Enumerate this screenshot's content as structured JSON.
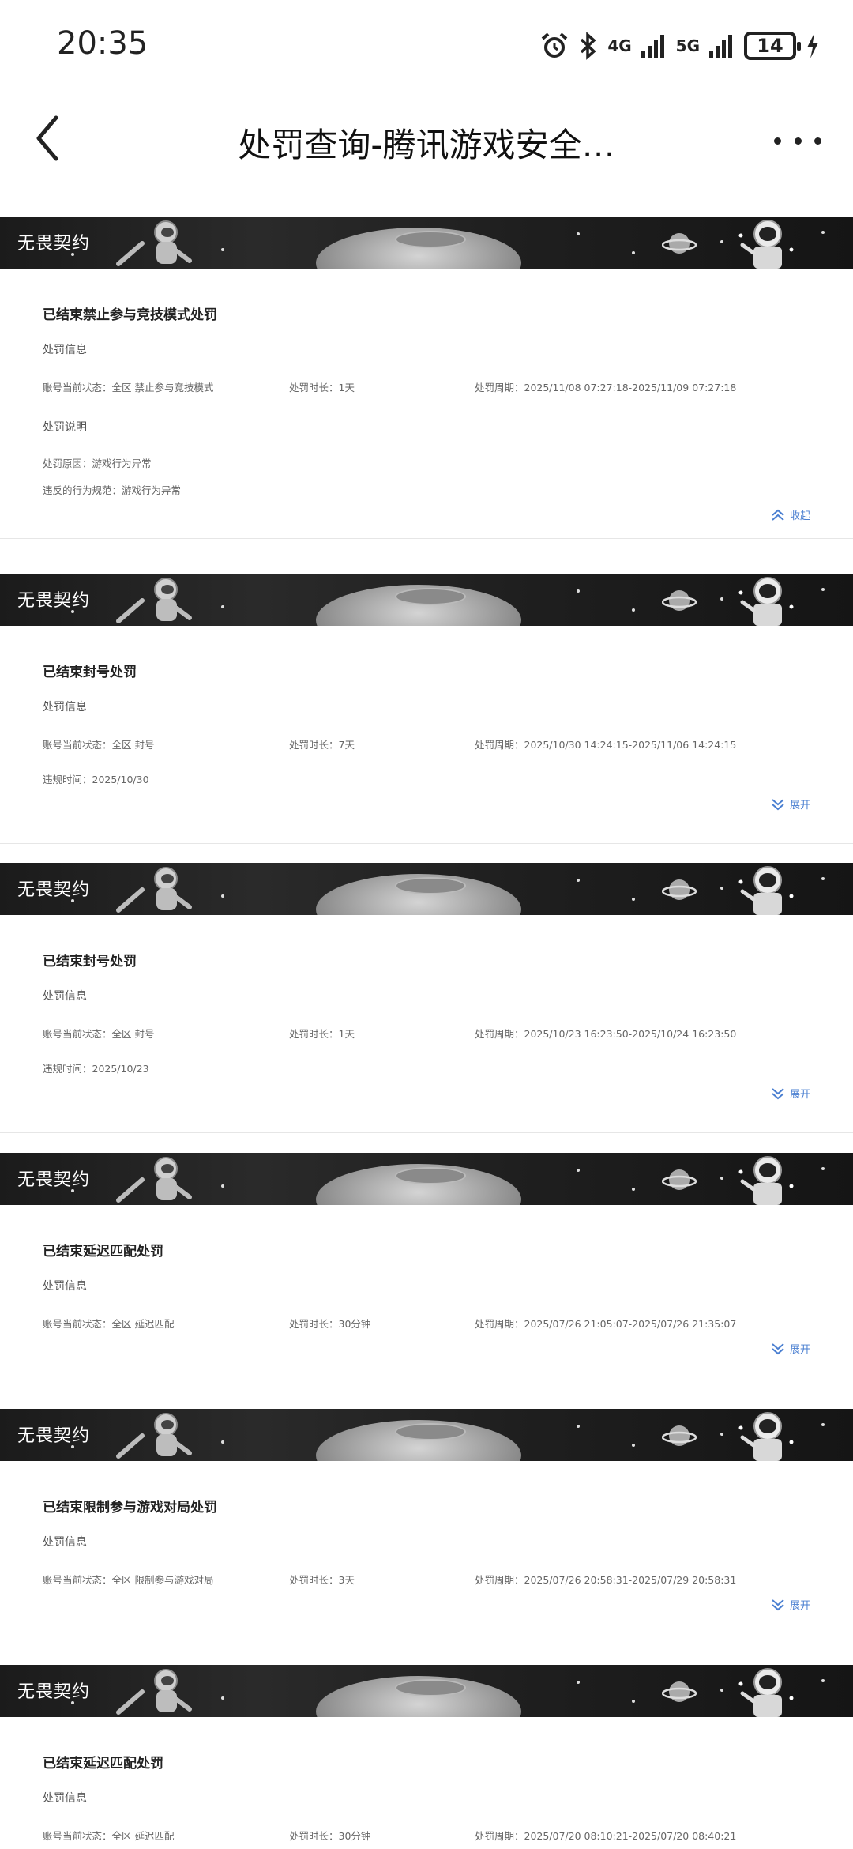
{
  "status_bar": {
    "time": "20:35",
    "net_4g": "4G",
    "net_5g": "5G",
    "battery": "14",
    "icons": [
      "alarm-icon",
      "bluetooth-icon",
      "signal-4g-icon",
      "signal-5g-icon",
      "battery-icon",
      "charging-icon"
    ]
  },
  "nav": {
    "title": "处罚查询-腾讯游戏安全…",
    "back_icon": "back-chevron-icon",
    "more_icon": "more-dots-icon"
  },
  "banner_label": "无畏契约",
  "labels": {
    "info_section": "处罚信息",
    "desc_section": "处罚说明",
    "collapse": "收起",
    "expand": "展开"
  },
  "cards": [
    {
      "title": "已结束禁止参与竞技模式处罚",
      "status": "账号当前状态：全区 禁止参与竞技模式",
      "duration": "处罚时长：1天",
      "period": "处罚周期：2025/11/08 07:27:18-2025/11/09 07:27:18",
      "reason": "处罚原因：游戏行为异常",
      "rule": "违反的行为规范：游戏行为异常",
      "expanded": true
    },
    {
      "title": "已结束封号处罚",
      "status": "账号当前状态：全区 封号",
      "duration": "处罚时长：7天",
      "period": "处罚周期：2025/10/30 14:24:15-2025/11/06 14:24:15",
      "violation_time": "违规时间：2025/10/30",
      "expanded": false
    },
    {
      "title": "已结束封号处罚",
      "status": "账号当前状态：全区 封号",
      "duration": "处罚时长：1天",
      "period": "处罚周期：2025/10/23 16:23:50-2025/10/24 16:23:50",
      "violation_time": "违规时间：2025/10/23",
      "expanded": false
    },
    {
      "title": "已结束延迟匹配处罚",
      "status": "账号当前状态：全区 延迟匹配",
      "duration": "处罚时长：30分钟",
      "period": "处罚周期：2025/07/26 21:05:07-2025/07/26 21:35:07",
      "expanded": false
    },
    {
      "title": "已结束限制参与游戏对局处罚",
      "status": "账号当前状态：全区 限制参与游戏对局",
      "duration": "处罚时长：3天",
      "period": "处罚周期：2025/07/26 20:58:31-2025/07/29 20:58:31",
      "expanded": false
    },
    {
      "title": "已结束延迟匹配处罚",
      "status": "账号当前状态：全区 延迟匹配",
      "duration": "处罚时长：30分钟",
      "period": "处罚周期：2025/07/20 08:10:21-2025/07/20 08:40:21",
      "expanded": false
    }
  ]
}
